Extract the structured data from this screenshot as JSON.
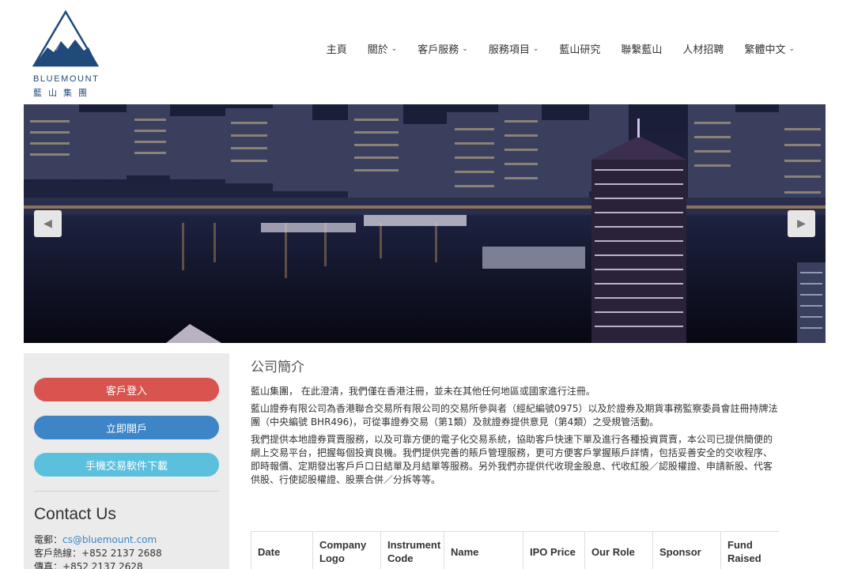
{
  "brand": {
    "name_en": "BLUEMOUNT",
    "name_zh": "藍山集團",
    "color": "#1f4a7a"
  },
  "nav": {
    "items": [
      {
        "label": "主頁",
        "dropdown": false
      },
      {
        "label": "關於",
        "dropdown": true
      },
      {
        "label": "客戶服務",
        "dropdown": true
      },
      {
        "label": "服務項目",
        "dropdown": true
      },
      {
        "label": "藍山研究",
        "dropdown": false
      },
      {
        "label": "聯繫藍山",
        "dropdown": false
      },
      {
        "label": "人材招聘",
        "dropdown": false
      },
      {
        "label": "繁體中文",
        "dropdown": true
      }
    ]
  },
  "banner": {
    "image": "hong-kong-harbour-night-skyline",
    "prev_icon": "chevron-left-icon",
    "next_icon": "chevron-right-icon"
  },
  "sidebar": {
    "login_label": "客戶登入",
    "open_account_label": "立即開戶",
    "app_download_label": "手機交易軟件下載",
    "login_color": "#d9534f",
    "open_color": "#3d85c6",
    "app_color": "#5bc0de",
    "contact_title": "Contact Us",
    "email_label": "電郵：",
    "email": "cs@bluemount.com",
    "hotline_label": "客戶熱線：",
    "hotline": "+852 2137 2688",
    "fax_label": "傳真：",
    "fax": "+852 2137 2628"
  },
  "main": {
    "title": "公司簡介",
    "paragraphs": [
      "藍山集團， 在此澄清，我們僅在香港注冊，並未在其他任何地區或國家進行注冊。",
      "藍山證券有限公司為香港聯合交易所有限公司的交易所參與者（經紀編號0975）以及於證券及期貨事務監察委員會註冊持牌法團（中央編號 BHR496)，可從事證券交易（第1類）及就證券提供意見（第4類）之受規管活動。",
      "我們提供本地證券買賣服務，以及可靠方便的電子化交易系統，協助客戶快速下單及進行各種投資買賣，本公司已提供簡便的網上交易平台，把握每個投資良機。我們提供完善的賬戶管理服務，更可方便客戶掌握賬戶詳情，包括妥善安全的交收程序、即時報價、定期發出客戶戶口日結單及月結單等服務。另外我們亦提供代收現金股息、代收紅股／認股權證、申請新股、代客供股、行使認股權證、股票合併／分拆等等。"
    ]
  },
  "table": {
    "headers": [
      "Date",
      "Company Logo",
      "Instrument Code",
      "Name",
      "IPO Price",
      "Our Role",
      "Sponsor",
      "Fund Raised"
    ]
  }
}
